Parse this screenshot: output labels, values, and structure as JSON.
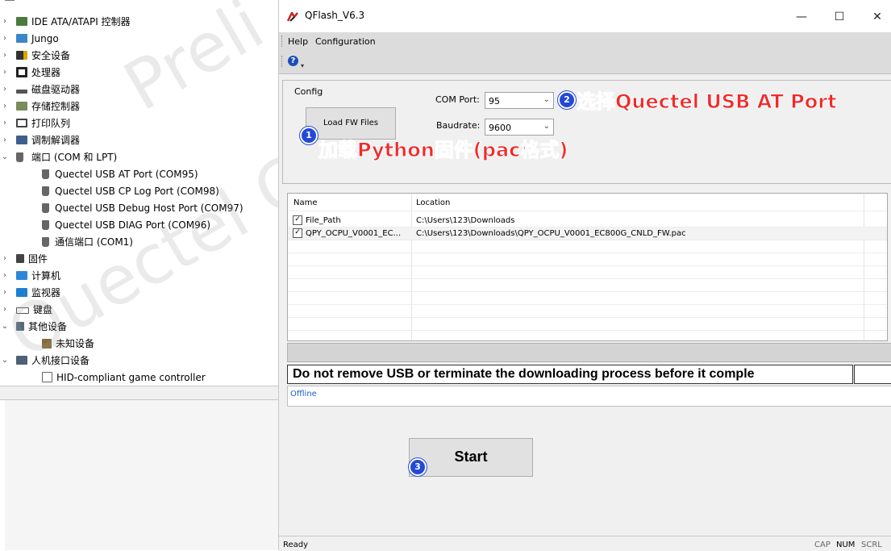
{
  "device_manager": {
    "categories": [
      {
        "label": "IDE ATA/ATAPI 控制器",
        "expanded": false
      },
      {
        "label": "Jungo",
        "expanded": false
      },
      {
        "label": "安全设备",
        "expanded": false
      },
      {
        "label": "处理器",
        "expanded": false
      },
      {
        "label": "磁盘驱动器",
        "expanded": false
      },
      {
        "label": "存储控制器",
        "expanded": false
      },
      {
        "label": "打印队列",
        "expanded": false
      },
      {
        "label": "调制解调器",
        "expanded": false
      },
      {
        "label": "端口 (COM 和 LPT)",
        "expanded": true
      },
      {
        "label": "固件",
        "expanded": false
      },
      {
        "label": "计算机",
        "expanded": false
      },
      {
        "label": "监视器",
        "expanded": false
      },
      {
        "label": "键盘",
        "expanded": false
      },
      {
        "label": "其他设备",
        "expanded": true
      },
      {
        "label": "人机接口设备",
        "expanded": true
      }
    ],
    "ports": [
      "Quectel USB AT Port (COM95)",
      "Quectel USB CP Log Port (COM98)",
      "Quectel USB Debug Host Port (COM97)",
      "Quectel USB DIAG Port (COM96)",
      "通信端口 (COM1)"
    ],
    "other_devices": [
      "未知设备"
    ],
    "hid_devices": [
      "HID-compliant game controller"
    ],
    "expand_glyph": "›",
    "collapse_glyph": "⌄"
  },
  "watermark": {
    "line1": "Preli",
    "line2": "Quectel Confi"
  },
  "qflash": {
    "title": "QFlash_V6.3",
    "window_controls": {
      "minimize": "—",
      "maximize": "☐",
      "close": "✕"
    },
    "menu": {
      "help": "Help",
      "configuration": "Configuration"
    },
    "toolbar": {
      "help_glyph": "?"
    },
    "config_label": "Config",
    "load_button": "Load FW Files",
    "com_port_label": "COM Port:",
    "com_port_value": "95",
    "baudrate_label": "Baudrate:",
    "baudrate_value": "9600",
    "select_arrow": "⌄",
    "columns": {
      "name": "Name",
      "location": "Location"
    },
    "files": [
      {
        "name": "File_Path",
        "location": "C:\\Users\\123\\Downloads",
        "checked": true
      },
      {
        "name": "QPY_OCPU_V0001_EC...",
        "location": "C:\\Users\\123\\Downloads\\QPY_OCPU_V0001_EC800G_CNLD_FW.pac",
        "checked": true
      }
    ],
    "check_glyph": "✓",
    "warning": "Do not remove USB or terminate the downloading process before it comple",
    "log_status": "Offline",
    "start_button": "Start",
    "status_ready": "Ready",
    "indicators": {
      "cap": "CAP",
      "num": "NUM",
      "scrl": "SCRL"
    }
  },
  "annotations": {
    "step1": {
      "number": "1",
      "text": "加载Python固件(pac格式)"
    },
    "step2": {
      "number": "2",
      "text": "选择Quectel USB AT Port"
    },
    "step3": {
      "number": "3"
    }
  },
  "colors": {
    "annotation_red": "#f12a2a",
    "badge_blue": "#2349d6"
  }
}
